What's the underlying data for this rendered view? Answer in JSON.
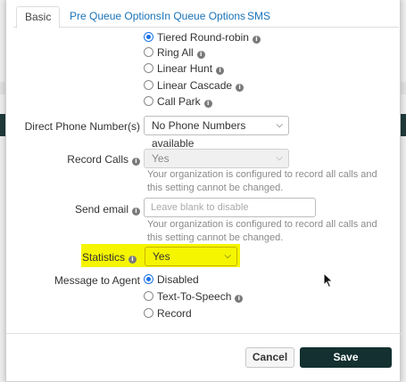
{
  "tabs": [
    "Basic",
    "Pre Queue Options",
    "In Queue Options",
    "SMS"
  ],
  "ring_strategy": {
    "options": [
      {
        "label": "Tiered Round-robin",
        "checked": true,
        "info": true
      },
      {
        "label": "Ring All",
        "checked": false,
        "info": true
      },
      {
        "label": "Linear Hunt",
        "checked": false,
        "info": true
      },
      {
        "label": "Linear Cascade",
        "checked": false,
        "info": true
      },
      {
        "label": "Call Park",
        "checked": false,
        "info": true
      }
    ]
  },
  "direct_phone": {
    "label": "Direct Phone Number(s)",
    "value": "No Phone Numbers available"
  },
  "record_calls": {
    "label": "Record Calls",
    "value": "Yes",
    "help": "Your organization is configured to record all calls and this setting cannot be changed."
  },
  "send_email": {
    "label": "Send email",
    "placeholder": "Leave blank to disable",
    "help": "Your organization is configured to record all calls and this setting cannot be changed."
  },
  "statistics": {
    "label": "Statistics",
    "value": "Yes",
    "highlight_color": "#f5f500"
  },
  "message_to_agent": {
    "label": "Message to Agent",
    "options": [
      {
        "label": "Disabled",
        "checked": true,
        "info": false
      },
      {
        "label": "Text-To-Speech",
        "checked": false,
        "info": true
      },
      {
        "label": "Record",
        "checked": false,
        "info": false
      }
    ]
  },
  "footer": {
    "cancel_label": "Cancel",
    "save_label": "Save"
  },
  "colors": {
    "save_bg": "#143030",
    "link": "#1a73b8",
    "radio_checked": "#1a73e8"
  }
}
